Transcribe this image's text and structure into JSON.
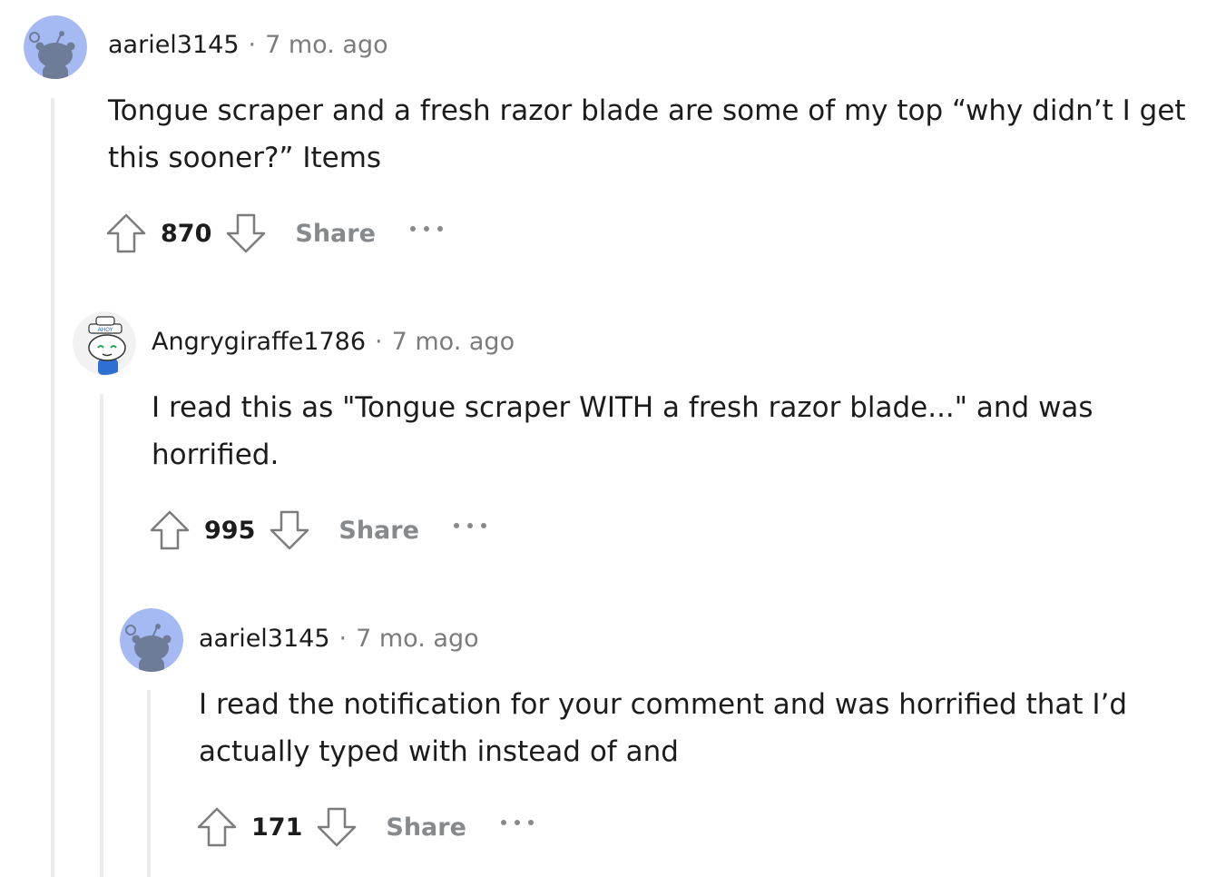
{
  "comments": [
    {
      "username": "aariel3145",
      "separator": "·",
      "time": "7 mo. ago",
      "body": "Tongue scraper and a fresh razor blade are some of my top “why didn’t I get this sooner?” Items",
      "score": "870",
      "share_label": "Share",
      "avatar_icon": "snoo-default-avatar",
      "avatar_color": "#a5b9f2"
    },
    {
      "username": "Angrygiraffe1786",
      "separator": "·",
      "time": "7 mo. ago",
      "body": "I read this as \"Tongue scraper WITH a fresh razor blade...\" and was horrified.",
      "score": "995",
      "share_label": "Share",
      "avatar_icon": "snoo-sailor-avatar",
      "avatar_hat_text": "AHOY"
    },
    {
      "username": "aariel3145",
      "separator": "·",
      "time": "7 mo. ago",
      "body": "I read the notification for your comment and was horrified that I’d actually typed with instead of and",
      "score": "171",
      "share_label": "Share",
      "avatar_icon": "snoo-default-avatar",
      "avatar_color": "#a5b9f2"
    }
  ],
  "icons": {
    "upvote": "upvote-arrow-icon",
    "downvote": "downvote-arrow-icon",
    "more": "more-options-icon"
  },
  "colors": {
    "muted": "#878a8c",
    "thread_line": "#ececec"
  }
}
